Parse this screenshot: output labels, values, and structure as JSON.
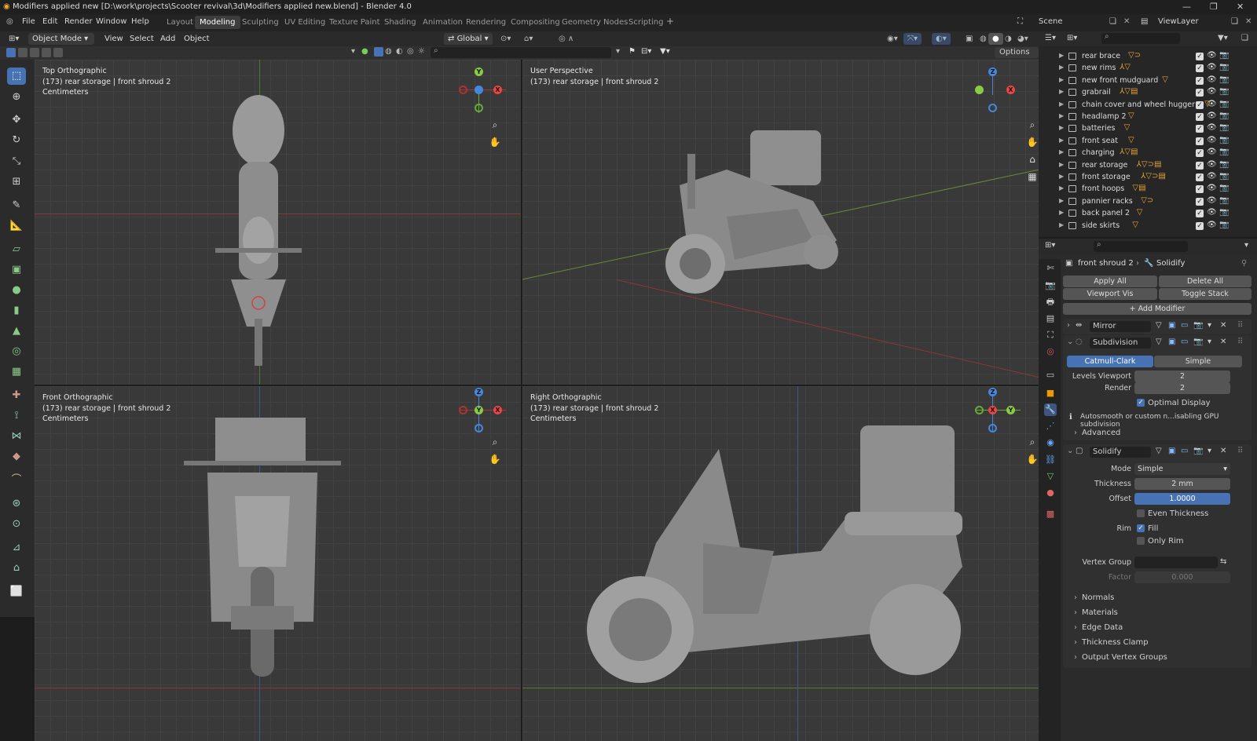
{
  "window": {
    "title": "Modifiers applied new [D:\\work\\projects\\Scooter revival\\3d\\Modifiers applied new.blend] - Blender 4.0"
  },
  "menu": {
    "file": "File",
    "edit": "Edit",
    "render": "Render",
    "window": "Window",
    "help": "Help"
  },
  "workspaces": [
    "Layout",
    "Modeling",
    "Sculpting",
    "UV Editing",
    "Texture Paint",
    "Shading",
    "Animation",
    "Rendering",
    "Compositing",
    "Geometry Nodes",
    "Scripting"
  ],
  "active_workspace": "Modeling",
  "scene": {
    "label": "Scene",
    "view_layer": "ViewLayer"
  },
  "header": {
    "mode": "Object Mode",
    "view": "View",
    "select": "Select",
    "add": "Add",
    "object": "Object",
    "orientation": "Global",
    "options": "Options"
  },
  "viewports": [
    {
      "name": "Top Orthographic",
      "info": "(173) rear storage | front shroud 2",
      "units": "Centimeters"
    },
    {
      "name": "User Perspective",
      "info": "(173) rear storage | front shroud 2",
      "units": ""
    },
    {
      "name": "Front Orthographic",
      "info": "(173) rear storage | front shroud 2",
      "units": "Centimeters"
    },
    {
      "name": "Right Orthographic",
      "info": "(173) rear storage | front shroud 2",
      "units": "Centimeters"
    }
  ],
  "outliner": [
    "rear brace",
    "new rims",
    "new front mudguard",
    "grabrail",
    "chain cover and wheel hugger",
    "headlamp 2",
    "batteries",
    "front seat",
    "charging",
    "rear storage",
    "front storage",
    "front hoops",
    "pannier racks",
    "back panel 2",
    "side skirts"
  ],
  "properties": {
    "breadcrumb_object": "front shroud 2",
    "breadcrumb_modifier": "Solidify",
    "apply_all": "Apply All",
    "delete_all": "Delete All",
    "viewport_vis": "Viewport Vis",
    "toggle_stack": "Toggle Stack",
    "add_modifier": "Add Modifier",
    "mirror": "Mirror",
    "subdivision": {
      "name": "Subdivision",
      "catmull": "Catmull-Clark",
      "simple": "Simple",
      "levels_label": "Levels Viewport",
      "levels": "2",
      "render_label": "Render",
      "render": "2",
      "optimal": "Optimal Display",
      "warning": "Autosmooth or custom n...isabling GPU subdivision",
      "advanced": "Advanced"
    },
    "solidify": {
      "name": "Solidify",
      "mode_label": "Mode",
      "mode": "Simple",
      "thickness_label": "Thickness",
      "thickness": "2 mm",
      "offset_label": "Offset",
      "offset": "1.0000",
      "even": "Even Thickness",
      "rim_label": "Rim",
      "fill": "Fill",
      "only_rim": "Only Rim",
      "vgroup_label": "Vertex Group",
      "factor_label": "Factor",
      "factor": "0.000"
    },
    "subpanels": [
      "Normals",
      "Materials",
      "Edge Data",
      "Thickness Clamp",
      "Output Vertex Groups"
    ]
  }
}
